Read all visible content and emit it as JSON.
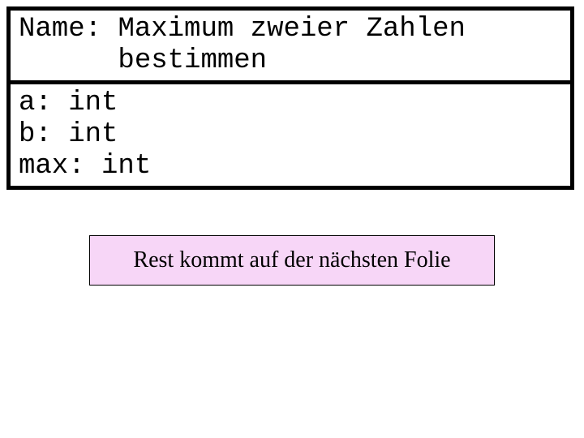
{
  "header": {
    "name_label": "Name:",
    "name_value_line1": "Maximum zweier Zahlen",
    "name_value_line2": "bestimmen"
  },
  "variables": {
    "a": "a: int",
    "b": "b: int",
    "max": "max: int"
  },
  "note": {
    "text": "Rest kommt auf der nächsten Folie"
  },
  "colors": {
    "note_bg": "#f7d6f7",
    "border": "#000000"
  }
}
